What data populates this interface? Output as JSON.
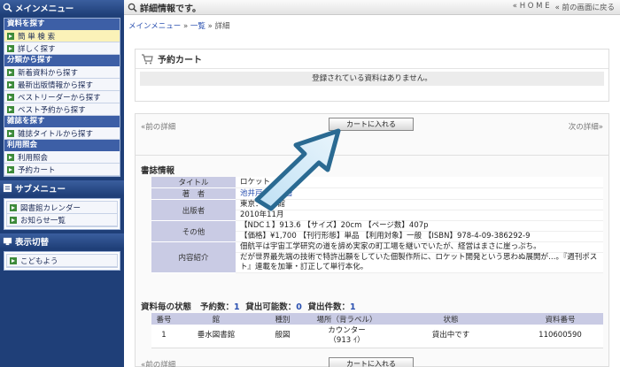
{
  "sidebar": {
    "main_menu": "メインメニュー",
    "sec_search": "資料を探す",
    "items_search": [
      "簡 単 検 索",
      "詳しく探す"
    ],
    "sec_category": "分類から探す",
    "items_category": [
      "新着資料から探す",
      "最新出版情報から探す",
      "ベストリーダーから探す",
      "ベスト予約から探す"
    ],
    "sec_magazine": "雑誌を探す",
    "items_magazine": [
      "雑誌タイトルから探す"
    ],
    "sec_use": "利用照会",
    "items_use": [
      "利用照会",
      "予約カート"
    ],
    "sub_menu": "サブメニュー",
    "items_sub": [
      "図書館カレンダー",
      "お知らせ一覧"
    ],
    "display_switch": "表示切替",
    "items_display": [
      "こどもよう"
    ]
  },
  "topbar": {
    "title": "詳細情報です。",
    "home": "« H O M E",
    "back": "« 前の画面に戻る"
  },
  "breadcrumb": {
    "main": "メインメニュー",
    "sep1": " » ",
    "list": "一覧",
    "sep2": " » ",
    "detail": "詳細"
  },
  "cart": {
    "title": "予約カート",
    "empty": "登録されている資料はありません。"
  },
  "nav": {
    "prev": "«前の詳細",
    "next": "次の詳細»",
    "add_to_cart": "カートに入れる"
  },
  "biblio": {
    "heading": "書誌情報",
    "rows": [
      {
        "label": "タイトル",
        "value": "ロケット"
      },
      {
        "label": "著　者",
        "value": "池井戸　潤／著"
      },
      {
        "label": "出版者",
        "value": "東京：小学館"
      },
      {
        "label": "",
        "value": "2010年11月"
      },
      {
        "label": "その他",
        "value": "【NDC１】913.6 【サイズ】20cm 【ページ数】407p"
      },
      {
        "label": "",
        "value": "【価格】¥1,700 【刊行形態】単品 【利用対象】一般 【ISBN】978-4-09-386292-9"
      },
      {
        "label": "内容紹介",
        "value": "佃航平は宇宙工学研究の道を諦め実家の町工場を継いでいたが、経営はまさに崖っぷち。"
      },
      {
        "label": "",
        "value": "だが世界最先端の技術で特許出願をしていた佃製作所に、ロケット開発という思わぬ展開が…。『週刊ポスト』連載を加筆・訂正して単行本化。"
      }
    ]
  },
  "holdings": {
    "label": "資料毎の状態",
    "reserve_label": "予約数：",
    "reserve": "1",
    "avail_label": "貸出可能数：",
    "avail": "0",
    "loan_label": "貸出件数：",
    "loan": "1",
    "headers": [
      "番号",
      "館",
      "種別",
      "場所（背ラベル）",
      "状態",
      "資料番号"
    ],
    "rows": [
      {
        "no": "1",
        "library": "垂水図書館",
        "type": "般図",
        "place": "カウンター",
        "label": "（913 ｲ）",
        "status": "貸出中です",
        "id": "110600590"
      }
    ]
  }
}
